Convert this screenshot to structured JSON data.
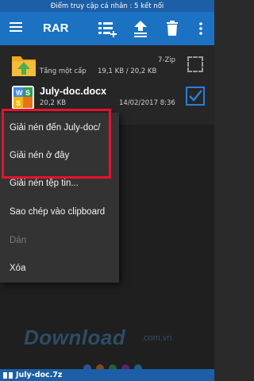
{
  "status_bar": {
    "text": "Điểm truy cập cá nhân : 5 kết nối"
  },
  "toolbar": {
    "title": "RAR",
    "icons": [
      "menu-icon",
      "add-to-archive-icon",
      "extract-icon",
      "delete-icon",
      "more-vert-icon"
    ]
  },
  "files": {
    "up": {
      "name": "Tầng một cấp",
      "type": "7-Zip",
      "size": "19,1 KB / 20,2 KB"
    },
    "doc": {
      "name": "July-doc.docx",
      "size": "20,2 KB",
      "date": "14/02/2017 8:36"
    }
  },
  "menu": {
    "items": [
      {
        "label": "Giải nén đến July-doc/",
        "enabled": true
      },
      {
        "label": "Giải nén ở đây",
        "enabled": true
      },
      {
        "label": "Giải nén tệp tin...",
        "enabled": true
      },
      {
        "label": "Sao chép vào clipboard",
        "enabled": true
      },
      {
        "label": "Dán",
        "enabled": false
      },
      {
        "label": "Xóa",
        "enabled": true
      }
    ]
  },
  "watermark": {
    "main": "Download",
    "sub": ".com.vn"
  },
  "bottom_bar": {
    "archive_name": "July-doc.7z"
  },
  "colors": {
    "toolbar": "#1b71c2",
    "status_bar": "#1c5fa6",
    "highlight": "#e8112d",
    "menu_bg": "#333333",
    "checkbox": "#2a7fd8"
  }
}
